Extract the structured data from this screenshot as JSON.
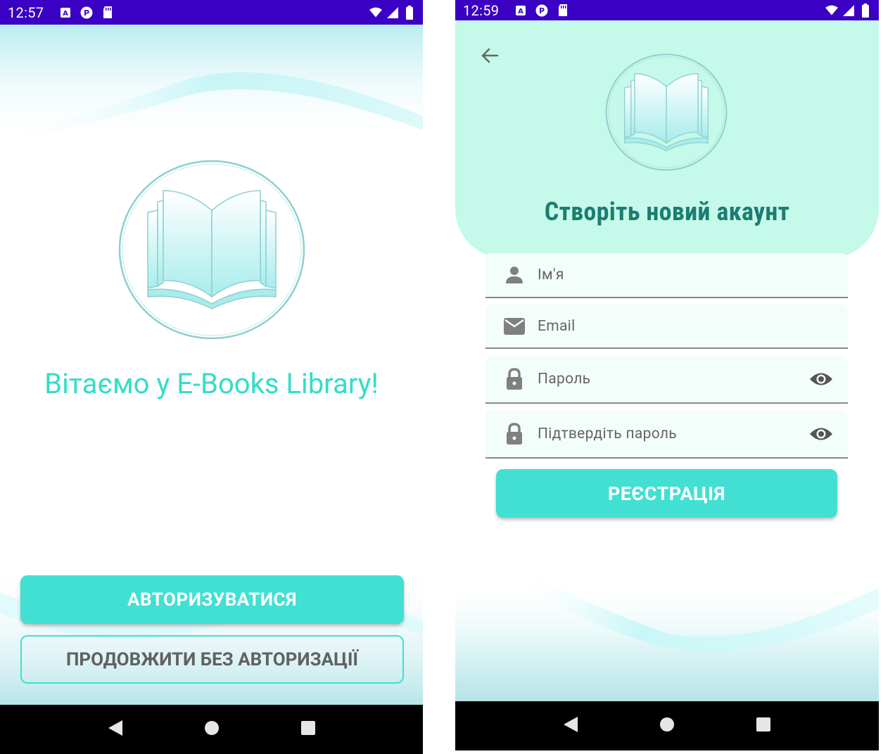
{
  "welcome": {
    "status_time": "12:57",
    "title": "Вітаємо у E-Books Library!",
    "login_button": "Авторизуватися",
    "guest_button": "Продовжити без авторизації"
  },
  "register": {
    "status_time": "12:59",
    "title": "Створіть новий акаунт",
    "fields": {
      "name": "Ім'я",
      "email": "Email",
      "password": "Пароль",
      "confirm": "Підтвердіть пароль"
    },
    "register_button": "Реєстрація"
  },
  "icons": {
    "status": [
      "notification-a-icon",
      "notification-p-icon",
      "sd-card-icon",
      "wifi-icon",
      "signal-icon",
      "battery-icon"
    ],
    "nav": [
      "back-triangle-icon",
      "home-circle-icon",
      "recents-square-icon"
    ],
    "register": [
      "back-arrow-icon",
      "person-icon",
      "email-icon",
      "lock-icon",
      "eye-icon"
    ]
  },
  "colors": {
    "status_bar": "#3a00c4",
    "accent": "#41e0d2",
    "title_welcome": "#33ddc8",
    "title_register": "#1c7d72",
    "header_bg": "#c5f9e9"
  }
}
